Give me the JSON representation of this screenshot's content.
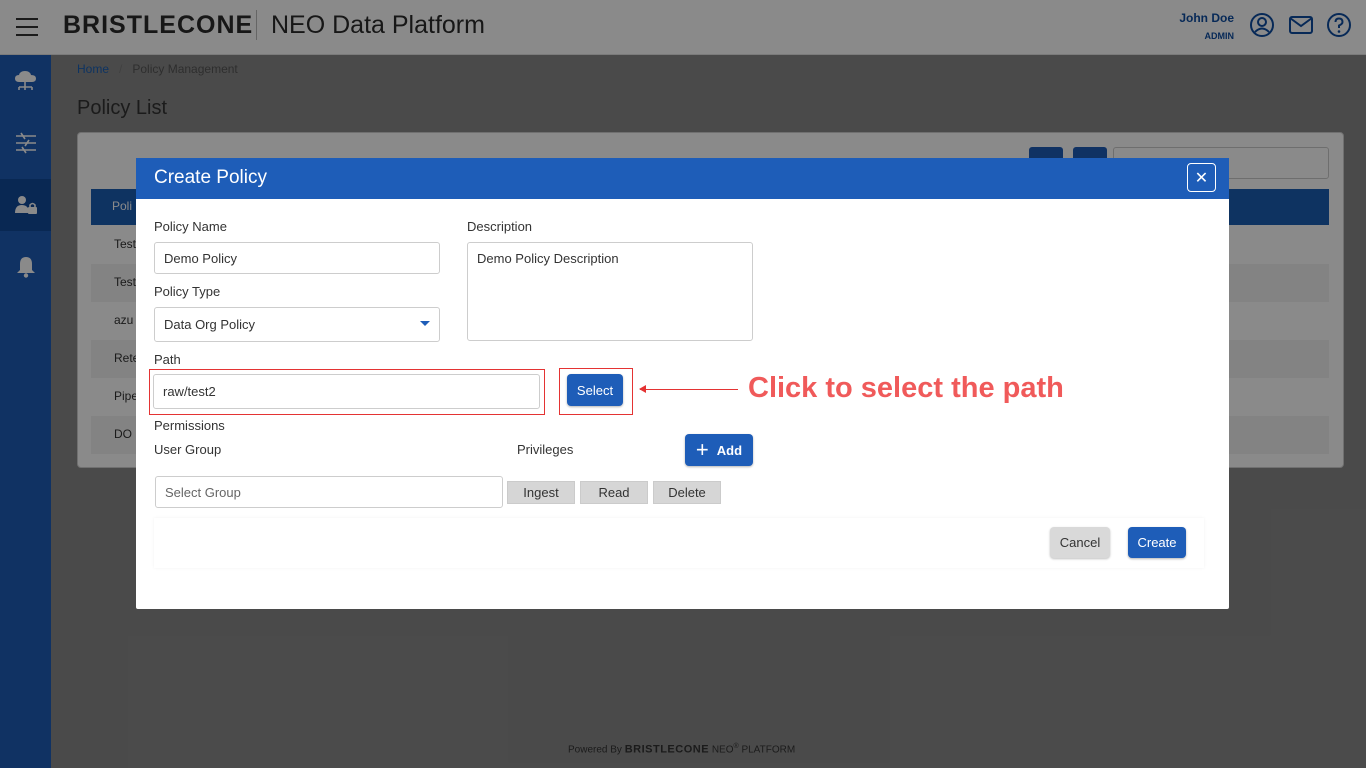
{
  "header": {
    "brand": "BRISTLECONE",
    "app_title": "NEO Data Platform",
    "user_name": "John Doe",
    "user_role": "ADMIN",
    "icons": [
      "menu-icon",
      "user-icon",
      "mail-icon",
      "help-icon"
    ]
  },
  "sidebar": {
    "items": [
      {
        "icon": "cloud-network-icon",
        "active": false
      },
      {
        "icon": "sliders-icon",
        "active": false
      },
      {
        "icon": "user-lock-icon",
        "active": true
      },
      {
        "icon": "bell-icon",
        "active": false
      }
    ]
  },
  "breadcrumb": {
    "home": "Home",
    "separator": "/",
    "current": "Policy Management"
  },
  "page_title": "Policy List",
  "list": {
    "header_label": "Poli",
    "rows": [
      "Test",
      "Test",
      "azu",
      "Rete",
      "Pipe",
      "DO F"
    ]
  },
  "modal": {
    "title": "Create Policy",
    "close_symbol": "✕",
    "policy_name_label": "Policy Name",
    "policy_name_value": "Demo Policy",
    "description_label": "Description",
    "description_value": "Demo Policy Description",
    "policy_type_label": "Policy Type",
    "policy_type_value": "Data Org Policy",
    "path_label": "Path",
    "path_value": "raw/test2",
    "select_button": "Select",
    "permissions_label": "Permissions",
    "user_group_label": "User Group",
    "privileges_label": "Privileges",
    "add_button": "Add",
    "select_group_placeholder": "Select Group",
    "privileges": [
      "Ingest",
      "Read",
      "Delete"
    ],
    "cancel_button": "Cancel",
    "create_button": "Create"
  },
  "annotation": {
    "text": "Click to select the path",
    "color": "#f05a5a"
  },
  "footer": {
    "powered_by": "Powered By",
    "brand": "BRISTLECONE",
    "neo": "NEO",
    "registered": "®",
    "platform": "PLATFORM"
  },
  "colors": {
    "primary": "#1e5db8",
    "sidebar": "#1e5db8",
    "highlight": "#e43333"
  }
}
